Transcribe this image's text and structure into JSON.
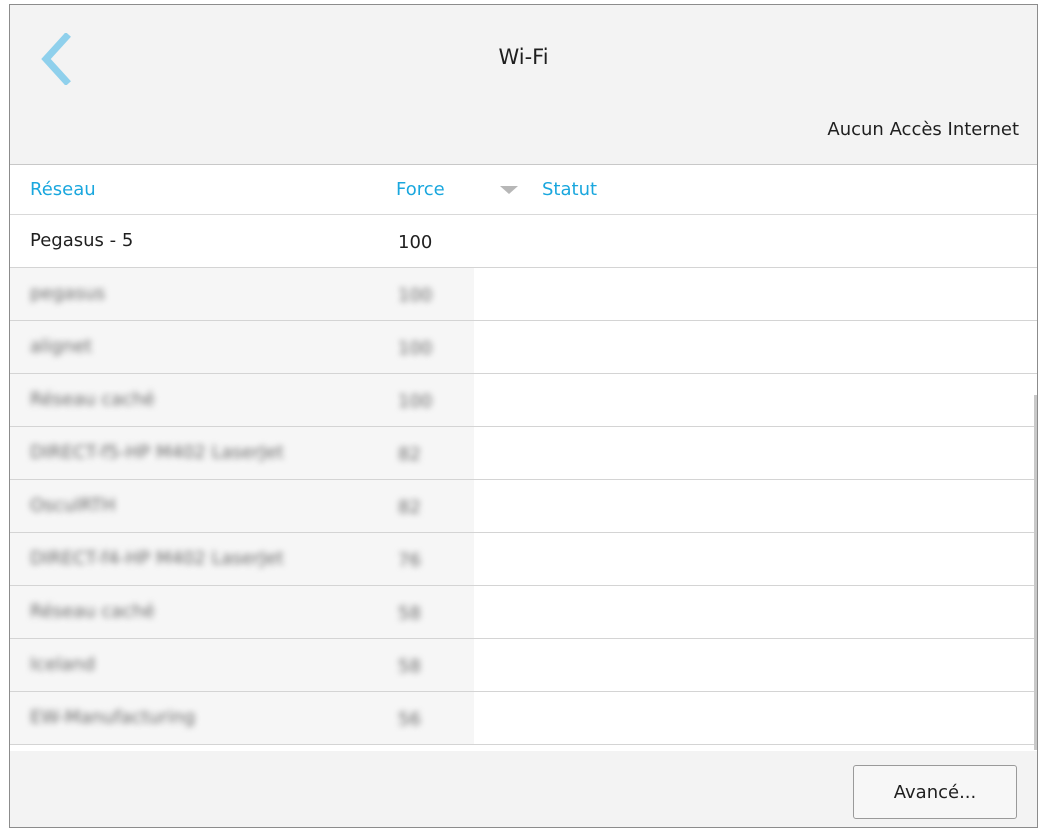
{
  "header": {
    "title": "Wi-Fi",
    "back_icon": "chevron-left-icon",
    "back_color": "#8fd0ec",
    "connection_status": "Aucun Accès Internet"
  },
  "table": {
    "columns": {
      "network": "Réseau",
      "strength": "Force",
      "status": "Statut"
    },
    "sort_icon": "sort-down-icon",
    "accent_color": "#1aa7de",
    "rows": [
      {
        "network": "Pegasus - 5",
        "strength": "100",
        "status": ""
      },
      {
        "network": "pegasus",
        "strength": "100",
        "status": ""
      },
      {
        "network": "alignet",
        "strength": "100",
        "status": ""
      },
      {
        "network": "Réseau caché",
        "strength": "100",
        "status": ""
      },
      {
        "network": "DIRECT-f5-HP M402 LaserJet",
        "strength": "82",
        "status": ""
      },
      {
        "network": "OsculRTH",
        "strength": "82",
        "status": ""
      },
      {
        "network": "DIRECT-f4-HP M402 LaserJet",
        "strength": "76",
        "status": ""
      },
      {
        "network": "Réseau caché",
        "strength": "58",
        "status": ""
      },
      {
        "network": "Iceland",
        "strength": "58",
        "status": ""
      },
      {
        "network": "EW-Manufacturing",
        "strength": "56",
        "status": ""
      }
    ]
  },
  "footer": {
    "advanced_label": "Avancé..."
  }
}
